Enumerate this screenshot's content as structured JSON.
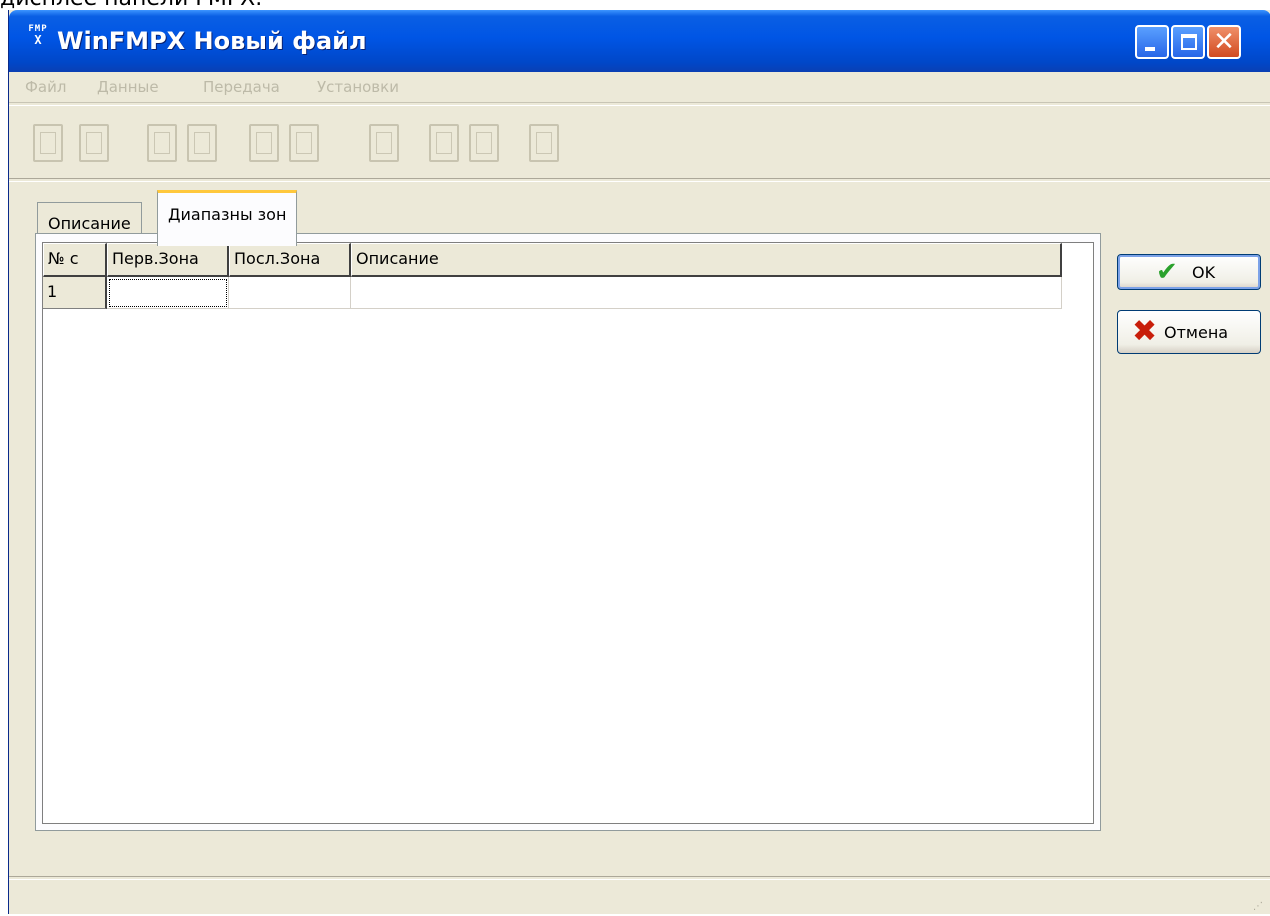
{
  "document": {
    "caption_fragment": "дисплее панели FMPX."
  },
  "window": {
    "title": "WinFMPX Новый файл",
    "app_icon_top": "FMP",
    "app_icon_bottom": "X",
    "controls": {
      "minimize": "minimize-icon",
      "maximize": "maximize-icon",
      "close": "close-icon"
    },
    "close_glyph": "✕"
  },
  "menu": {
    "items": [
      {
        "label": "Файл"
      },
      {
        "label": "Данные"
      },
      {
        "label": "Передача"
      },
      {
        "label": "Установки"
      }
    ]
  },
  "toolbar": {
    "buttons": [
      {
        "icon": "new-file-icon"
      },
      {
        "icon": "open-folder-icon"
      },
      {
        "icon": "save-icon"
      },
      {
        "icon": "save-as-icon"
      },
      {
        "icon": "print-icon"
      },
      {
        "icon": "print-setup-icon"
      },
      {
        "icon": "preview-icon"
      },
      {
        "icon": "receive-icon"
      },
      {
        "icon": "send-icon"
      },
      {
        "icon": "panel-icon"
      }
    ]
  },
  "tabs": [
    {
      "label": "Описание",
      "active": false
    },
    {
      "label": "Диапазны зон",
      "active": true
    }
  ],
  "grid": {
    "columns": [
      "№ с",
      "Перв.Зона",
      "Посл.Зона",
      "Описание"
    ],
    "rows": [
      [
        "1",
        "",
        "",
        ""
      ]
    ]
  },
  "buttons": {
    "ok": {
      "label": "OK",
      "icon": "checkmark-icon",
      "glyph": "✔",
      "color": "#2aa12c"
    },
    "cancel": {
      "label": "Отмена",
      "icon": "cross-icon",
      "glyph": "✖",
      "color": "#c81e0a"
    }
  },
  "colors": {
    "titlebar": "#0055e5",
    "window_bg": "#ece9d8",
    "active_tab_highlight": "#ffc83c"
  },
  "statusbar": {
    "grip_glyph": "⋰"
  }
}
